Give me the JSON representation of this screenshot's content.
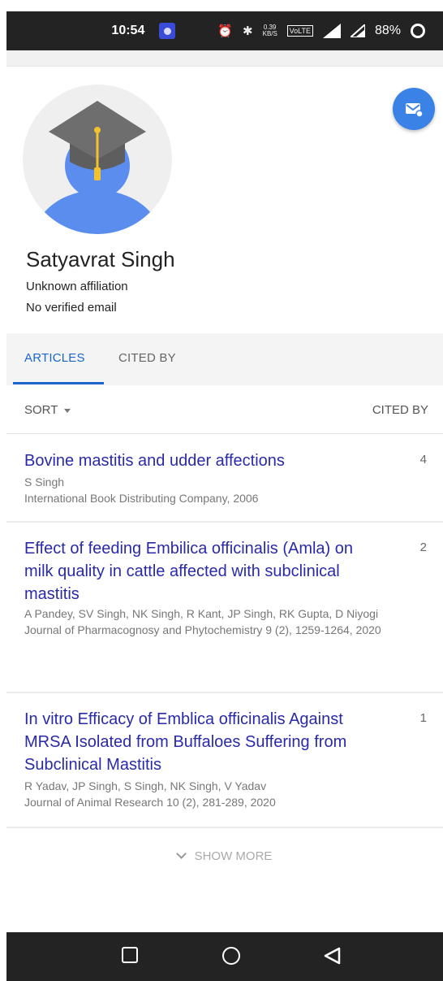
{
  "status_bar": {
    "time": "10:54",
    "battery": "88%",
    "icons": [
      "app-notification-icon",
      "alarm-icon",
      "bluetooth-icon",
      "data-speed-icon",
      "volte-icon",
      "signal-icon",
      "signal-icon-2",
      "battery-ring-icon"
    ],
    "data_speed": "0.39 KB/S",
    "volte": "VoLTE"
  },
  "profile": {
    "name": "Satyavrat Singh",
    "affiliation": "Unknown affiliation",
    "email": "No verified email",
    "follow_icon": "email-follow-icon",
    "avatar_icon": "graduate-avatar-icon"
  },
  "tabs": [
    {
      "label": "ARTICLES",
      "active": true
    },
    {
      "label": "CITED BY",
      "active": false
    }
  ],
  "list_header": {
    "sort_label": "SORT",
    "cited_by_label": "CITED BY"
  },
  "articles": [
    {
      "title": "Bovine mastitis and udder affections",
      "authors": "S Singh",
      "venue": "International Book Distributing Company, 2006",
      "cited_by": "4"
    },
    {
      "title": "Effect of feeding Embilica officinalis (Amla) on milk quality in cattle affected with subclinical mastitis",
      "authors": "A Pandey, SV Singh, NK Singh, R Kant, JP Singh, RK Gupta, D Niyogi",
      "venue": "Journal of Pharmacognosy and Phytochemistry 9 (2), 1259-1264, 2020",
      "cited_by": "2"
    },
    {
      "title": "In vitro Efficacy of Emblica officinalis Against MRSA Isolated from Buffaloes Suffering from Subclinical Mastitis",
      "authors": "R Yadav, JP Singh, S Singh, NK Singh, V Yadav",
      "venue": "Journal of Animal Research 10 (2), 281-289, 2020",
      "cited_by": "1"
    }
  ],
  "show_more_label": "SHOW MORE",
  "colors": {
    "accent": "#1a66c9",
    "title_link": "#2a2aa8",
    "follow_button": "#3b82e6",
    "avatar_body": "#5b8def",
    "avatar_cap": "#6e6e6e",
    "tassel": "#f2c12e"
  },
  "nav_bar": {
    "icons": [
      "recent-apps-icon",
      "home-icon",
      "back-icon"
    ]
  }
}
